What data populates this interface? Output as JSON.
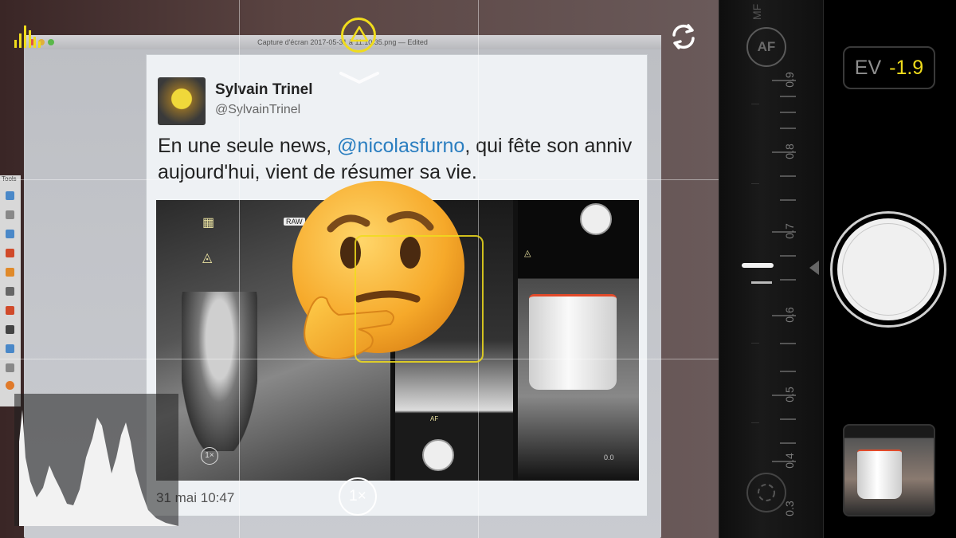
{
  "viewfinder": {
    "document_title": "Capture d'écran 2017-05-31 à 11.10.35.png — Edited",
    "tweet": {
      "name": "Sylvain Trinel",
      "handle": "@SylvainTrinel",
      "text_before": "En une seule news, ",
      "mention": "@nicolasfurno",
      "text_after": ", qui fête son anniv aujourd'hui, vient de résumer sa vie.",
      "date": "31 mai 10:47",
      "media_labels": {
        "raw_badge": "RAW",
        "tile1_zoom": "1×",
        "tile2_af": "AF",
        "tile3_ev": "0.0"
      }
    },
    "toolbar_label": "Tools",
    "zoom_label": "1×"
  },
  "controls": {
    "mf_label": "MF",
    "af_label": "AF",
    "ev_label": "EV",
    "ev_value": "-1.9",
    "focus_scale": [
      "0.9",
      "0.8",
      "0.7",
      "0.6",
      "0.5",
      "0.4",
      "0.3"
    ]
  },
  "colors": {
    "accent": "#f0dc1c",
    "panel": "#000000"
  }
}
